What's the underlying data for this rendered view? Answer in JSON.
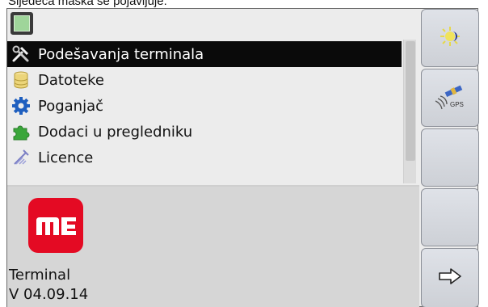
{
  "caption": "Sljedeća maska se pojavljuje:",
  "menu": {
    "items": [
      {
        "label": "Podešavanja terminala",
        "icon": "tools-icon",
        "selected": true
      },
      {
        "label": "Datoteke",
        "icon": "database-icon",
        "selected": false
      },
      {
        "label": "Poganjač",
        "icon": "gear-icon",
        "selected": false
      },
      {
        "label": "Dodaci u pregledniku",
        "icon": "puzzle-icon",
        "selected": false
      },
      {
        "label": "Licence",
        "icon": "license-icon",
        "selected": false
      }
    ]
  },
  "info": {
    "logo_text": "ME",
    "product": "Terminal",
    "version": "V 04.09.14"
  },
  "softkeys": {
    "gps_label": "GPS"
  },
  "colors": {
    "logo_red": "#e40a23",
    "selection_bg": "#0a0a0a",
    "softkey_bg": "#d6d9df"
  }
}
